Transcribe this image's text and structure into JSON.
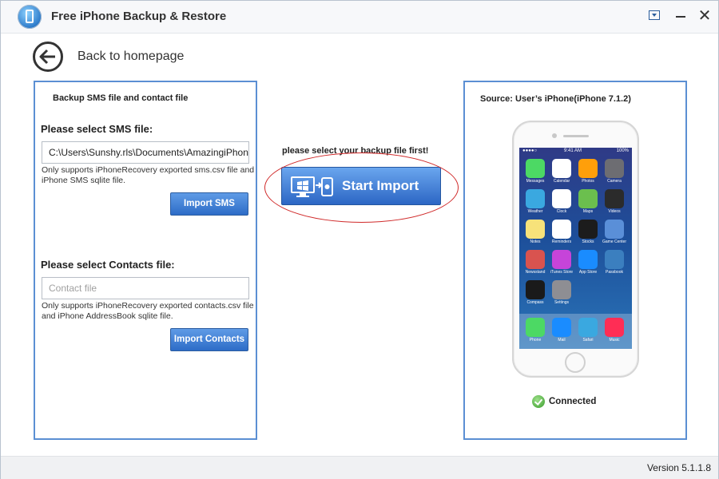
{
  "app": {
    "title": "Free iPhone Backup & Restore"
  },
  "nav": {
    "back_label": "Back to homepage"
  },
  "left_panel": {
    "title": "Backup SMS file and contact file",
    "sms": {
      "label": "Please select SMS file:",
      "value": "C:\\Users\\Sunshy.rls\\Documents\\AmazingiPhone",
      "note": "Only supports iPhoneRecovery exported sms.csv file and iPhone SMS sqlite file.",
      "button": "Import SMS"
    },
    "contacts": {
      "label": "Please select Contacts file:",
      "value": "",
      "placeholder": "Contact file",
      "note": "Only supports iPhoneRecovery exported contacts.csv file and iPhone AddressBook sqlite file.",
      "button": "Import Contacts"
    }
  },
  "center": {
    "hint": "please select your backup file first!",
    "start_button": "Start Import"
  },
  "right_panel": {
    "source": "Source: User’s iPhone(iPhone 7.1.2)",
    "status": "Connected",
    "status_color": "#3a9c2c",
    "device_screen": {
      "time": "9:41 AM",
      "battery": "100%",
      "apps": [
        "Messages",
        "Calendar",
        "Photos",
        "Camera",
        "Weather",
        "Clock",
        "Maps",
        "Videos",
        "Notes",
        "Reminders",
        "Stocks",
        "Game Center",
        "Newsstand",
        "iTunes Store",
        "App Store",
        "Passbook",
        "Compass",
        "Settings"
      ],
      "dock": [
        "Phone",
        "Mail",
        "Safari",
        "Music"
      ]
    }
  },
  "footer": {
    "version": "Version 5.1.1.8"
  },
  "colors": {
    "accent": "#2d6cc7",
    "panel_border": "#5b8fd3",
    "highlight": "#d02a2a"
  }
}
